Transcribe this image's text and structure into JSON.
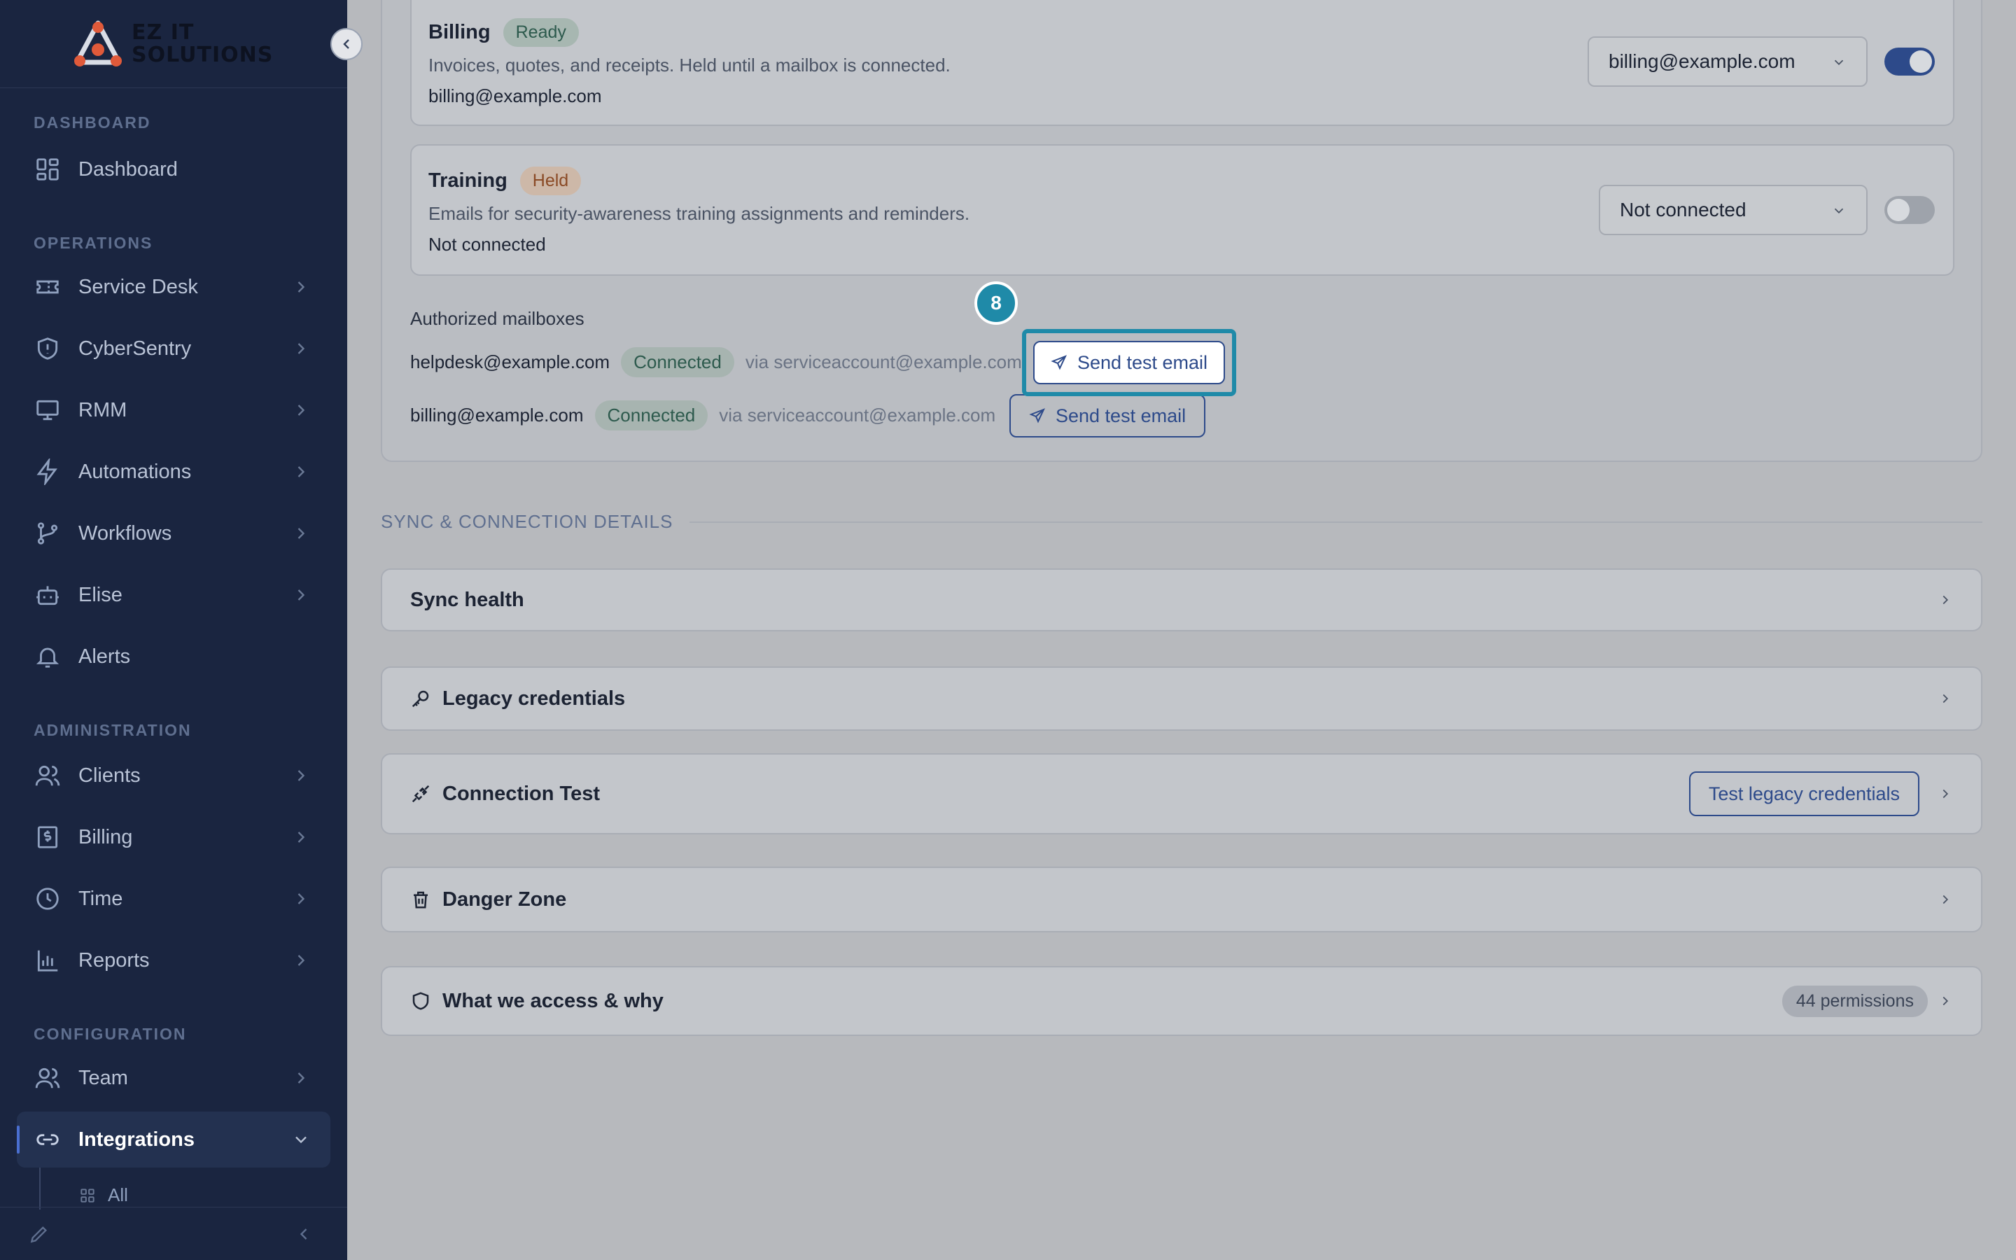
{
  "brand": {
    "line1": "EZ IT",
    "line2": "SOLUTIONS"
  },
  "sidebar": {
    "sections": {
      "dashboard": "DASHBOARD",
      "operations": "OPERATIONS",
      "administration": "ADMINISTRATION",
      "configuration": "CONFIGURATION"
    },
    "items": {
      "dashboard": "Dashboard",
      "service_desk": "Service Desk",
      "cybersentry": "CyberSentry",
      "rmm": "RMM",
      "automations": "Automations",
      "workflows": "Workflows",
      "elise": "Elise",
      "alerts": "Alerts",
      "clients": "Clients",
      "billing": "Billing",
      "time": "Time",
      "reports": "Reports",
      "team": "Team",
      "integrations": "Integrations",
      "all": "All"
    }
  },
  "mailboxes": {
    "billing": {
      "title": "Billing",
      "status": "Ready",
      "description": "Invoices, quotes, and receipts. Held until a mailbox is connected.",
      "address": "billing@example.com",
      "select_value": "billing@example.com",
      "enabled": true
    },
    "training": {
      "title": "Training",
      "status": "Held",
      "description": "Emails for security-awareness training assignments and reminders.",
      "address": "Not connected",
      "select_value": "Not connected",
      "enabled": false
    }
  },
  "authorized": {
    "heading": "Authorized mailboxes",
    "rows": [
      {
        "email": "helpdesk@example.com",
        "status": "Connected",
        "via": "via serviceaccount@example.com",
        "action": "Send test email"
      },
      {
        "email": "billing@example.com",
        "status": "Connected",
        "via": "via serviceaccount@example.com",
        "action": "Send test email"
      }
    ]
  },
  "step_badge": "8",
  "sync_section": {
    "heading": "SYNC & CONNECTION DETAILS",
    "sync_health": "Sync health",
    "legacy_credentials": "Legacy credentials",
    "connection_test": "Connection Test",
    "test_button": "Test legacy credentials",
    "danger_zone": "Danger Zone",
    "access_why": "What we access & why",
    "permissions": "44 permissions"
  },
  "colors": {
    "sidebar_bg": "#1a2540",
    "accent": "#2d4a8a",
    "highlight": "#1f8aa8",
    "connected": "#2d5a4d",
    "held": "#8a4a25"
  }
}
